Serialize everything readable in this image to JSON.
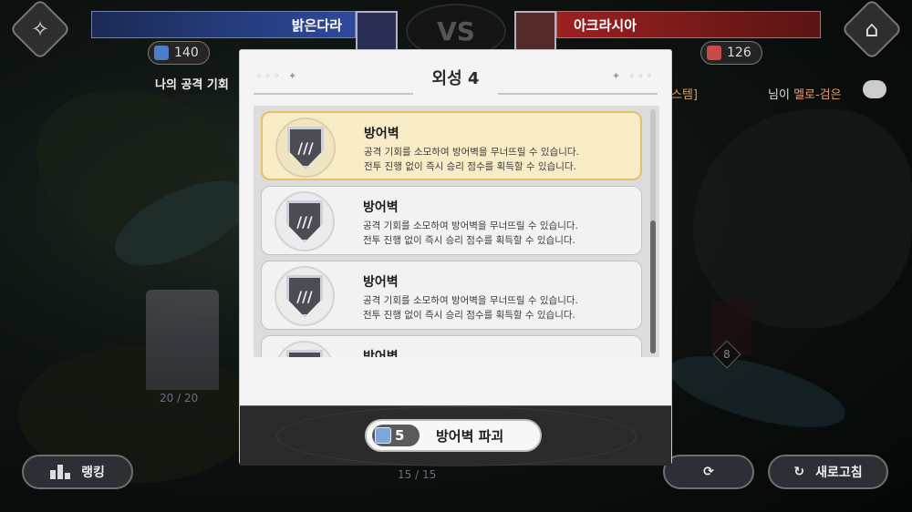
{
  "top": {
    "team_left": {
      "name": "밝은다라",
      "score": "140"
    },
    "team_right": {
      "name": "아크라시아",
      "score": "126"
    },
    "vs_label": "VS"
  },
  "status": {
    "my_chance": "나의 공격 기회",
    "bracket_text": "스템]",
    "right_prefix": "님이 ",
    "right_highlight": "멜로-검은"
  },
  "map": {
    "castle_count": "20 / 20",
    "bottom_count": "15 / 15",
    "enemy_badge": "8"
  },
  "modal": {
    "title": "외성 4",
    "cards": [
      {
        "title": "방어벽",
        "line1": "공격 기회를 소모하여 방어벽을 무너뜨릴 수 있습니다.",
        "line2": "전투 진행 없이 즉시 승리 점수를 획득할 수 있습니다."
      },
      {
        "title": "방어벽",
        "line1": "공격 기회를 소모하여 방어벽을 무너뜨릴 수 있습니다.",
        "line2": "전투 진행 없이 즉시 승리 점수를 획득할 수 있습니다."
      },
      {
        "title": "방어벽",
        "line1": "공격 기회를 소모하여 방어벽을 무너뜨릴 수 있습니다.",
        "line2": "전투 진행 없이 즉시 승리 점수를 획득할 수 있습니다."
      },
      {
        "title": "방어벽"
      }
    ],
    "action": {
      "cost": "5",
      "label": "방어벽 파괴"
    }
  },
  "buttons": {
    "ranking": "랭킹",
    "refresh": "새로고침"
  },
  "icons": {
    "left_corner": "diamond-emblem-icon",
    "right_corner": "home-icon",
    "score_left": "sword-icon",
    "score_right": "sword-icon",
    "chat": "chat-icon",
    "replay": "replay-icon",
    "refresh": "refresh-icon"
  }
}
